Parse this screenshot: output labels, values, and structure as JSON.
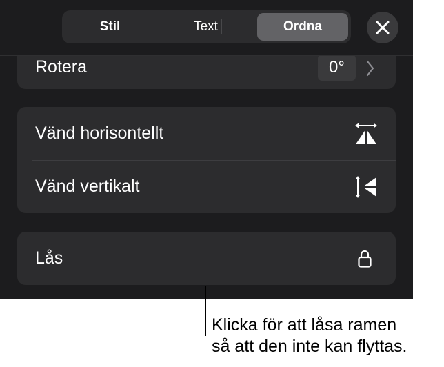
{
  "tabs": [
    {
      "label": "Stil",
      "active": false
    },
    {
      "label": "Text",
      "active": false
    },
    {
      "label": "Ordna",
      "active": true
    }
  ],
  "close_icon": "close-icon",
  "rotate": {
    "label": "Rotera",
    "value": "0°",
    "icon": "chevron-right-icon"
  },
  "flip": {
    "horizontal": {
      "label": "Vänd horisontellt",
      "icon": "flip-horizontal-icon"
    },
    "vertical": {
      "label": "Vänd vertikalt",
      "icon": "flip-vertical-icon"
    }
  },
  "lock": {
    "label": "Lås",
    "icon": "lock-icon"
  },
  "callout": {
    "line1": "Klicka för att låsa ramen",
    "line2": "så att den inte kan flyttas."
  },
  "colors": {
    "panel_bg": "#1c1c1e",
    "group_bg": "#2c2c2e",
    "active_segment": "#636366",
    "text": "#ffffff"
  }
}
